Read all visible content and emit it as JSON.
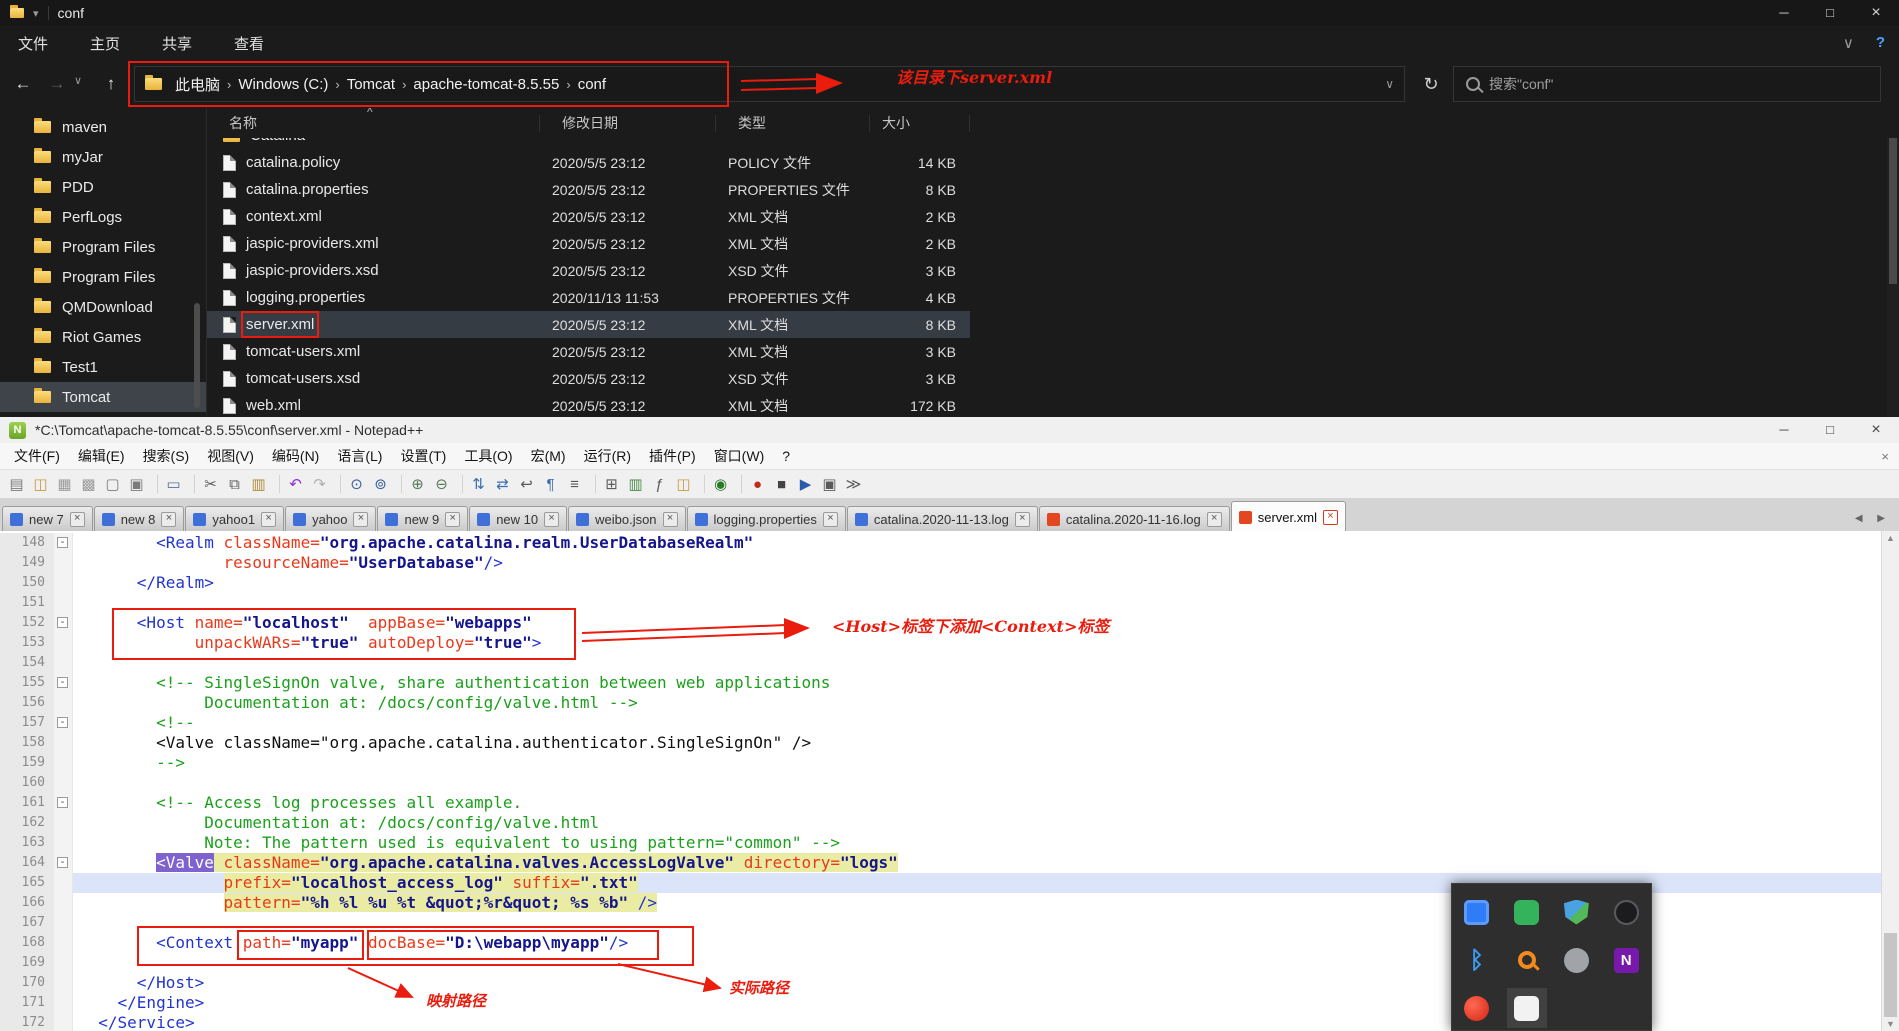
{
  "explorer": {
    "title": "conf",
    "window_controls": {
      "minimize": "─",
      "maximize": "□",
      "close": "×"
    },
    "menu_tabs": [
      "文件",
      "主页",
      "共享",
      "查看"
    ],
    "ribbon": {
      "collapse_caret": "∨",
      "help": "?"
    },
    "nav": {
      "back": "←",
      "forward": "→",
      "caret": "∨",
      "up": "↑",
      "refresh": "↻",
      "addr_caret": "∨"
    },
    "breadcrumb": [
      "此电脑",
      "Windows (C:)",
      "Tomcat",
      "apache-tomcat-8.5.55",
      "conf"
    ],
    "search_placeholder": "搜索\"conf\"",
    "columns": [
      "名称",
      "修改日期",
      "类型",
      "大小"
    ],
    "sort_caret": "^",
    "sidebar": [
      {
        "label": "maven"
      },
      {
        "label": "myJar"
      },
      {
        "label": "PDD"
      },
      {
        "label": "PerfLogs"
      },
      {
        "label": "Program Files"
      },
      {
        "label": "Program Files"
      },
      {
        "label": "QMDownload"
      },
      {
        "label": "Riot Games"
      },
      {
        "label": "Test1"
      },
      {
        "label": "Tomcat",
        "selected": true
      }
    ],
    "files": [
      {
        "name": "Catalina",
        "date": "",
        "type": "",
        "size": "",
        "folder": true,
        "clip_top": true
      },
      {
        "name": "catalina.policy",
        "date": "2020/5/5 23:12",
        "type": "POLICY 文件",
        "size": "14 KB"
      },
      {
        "name": "catalina.properties",
        "date": "2020/5/5 23:12",
        "type": "PROPERTIES 文件",
        "size": "8 KB"
      },
      {
        "name": "context.xml",
        "date": "2020/5/5 23:12",
        "type": "XML 文档",
        "size": "2 KB"
      },
      {
        "name": "jaspic-providers.xml",
        "date": "2020/5/5 23:12",
        "type": "XML 文档",
        "size": "2 KB"
      },
      {
        "name": "jaspic-providers.xsd",
        "date": "2020/5/5 23:12",
        "type": "XSD 文件",
        "size": "3 KB"
      },
      {
        "name": "logging.properties",
        "date": "2020/11/13 11:53",
        "type": "PROPERTIES 文件",
        "size": "4 KB"
      },
      {
        "name": "server.xml",
        "date": "2020/5/5 23:12",
        "type": "XML 文档",
        "size": "8 KB",
        "selected": true,
        "redbox": true
      },
      {
        "name": "tomcat-users.xml",
        "date": "2020/5/5 23:12",
        "type": "XML 文档",
        "size": "3 KB"
      },
      {
        "name": "tomcat-users.xsd",
        "date": "2020/5/5 23:12",
        "type": "XSD 文件",
        "size": "3 KB"
      },
      {
        "name": "web.xml",
        "date": "2020/5/5 23:12",
        "type": "XML 文档",
        "size": "172 KB"
      }
    ]
  },
  "notepad": {
    "title": "*C:\\Tomcat\\apache-tomcat-8.5.55\\conf\\server.xml - Notepad++",
    "icon_letter": "N",
    "window_controls": {
      "minimize": "─",
      "maximize": "□",
      "close": "×"
    },
    "menu_close": "×",
    "tab_scroll": "◀ ▶",
    "menus": [
      "文件(F)",
      "编辑(E)",
      "搜索(S)",
      "视图(V)",
      "编码(N)",
      "语言(L)",
      "设置(T)",
      "工具(O)",
      "宏(M)",
      "运行(R)",
      "插件(P)",
      "窗口(W)",
      "?"
    ],
    "toolbar": [
      {
        "name": "new-file-icon",
        "glyph": "▤",
        "color": "#7a7a7a"
      },
      {
        "name": "open-file-icon",
        "glyph": "◫",
        "color": "#c89a3f"
      },
      {
        "name": "save-icon",
        "glyph": "▦",
        "color": "#9a9a9a"
      },
      {
        "name": "save-all-icon",
        "glyph": "▩",
        "color": "#9a9a9a"
      },
      {
        "name": "close-doc-icon",
        "glyph": "▢",
        "color": "#7a7a7a"
      },
      {
        "name": "close-all-icon",
        "glyph": "▣",
        "color": "#7a7a7a"
      },
      {
        "sep": true
      },
      {
        "name": "print-icon",
        "glyph": "▭",
        "color": "#5a6f8a"
      },
      {
        "sep": true
      },
      {
        "name": "cut-icon",
        "glyph": "✂",
        "color": "#5a5a5a"
      },
      {
        "name": "copy-icon",
        "glyph": "⧉",
        "color": "#5a5a5a"
      },
      {
        "name": "paste-icon",
        "glyph": "▥",
        "color": "#b08a3a"
      },
      {
        "sep": true
      },
      {
        "name": "undo-icon",
        "glyph": "↶",
        "color": "#8a2be2"
      },
      {
        "name": "redo-icon",
        "glyph": "↷",
        "color": "#b0b0b0"
      },
      {
        "sep": true
      },
      {
        "name": "find-icon",
        "glyph": "⊙",
        "color": "#3a5f9a"
      },
      {
        "name": "replace-icon",
        "glyph": "⊚",
        "color": "#3a5f9a"
      },
      {
        "sep": true
      },
      {
        "name": "zoom-in-icon",
        "glyph": "⊕",
        "color": "#5a7a5a"
      },
      {
        "name": "zoom-out-icon",
        "glyph": "⊖",
        "color": "#5a7a5a"
      },
      {
        "sep": true
      },
      {
        "name": "sync-vertical-icon",
        "glyph": "⇅",
        "color": "#3a6fb0"
      },
      {
        "name": "sync-horizontal-icon",
        "glyph": "⇄",
        "color": "#3a6fb0"
      },
      {
        "name": "word-wrap-icon",
        "glyph": "↩",
        "color": "#5a5a5a"
      },
      {
        "name": "show-all-chars-icon",
        "glyph": "¶",
        "color": "#3a6fb0"
      },
      {
        "name": "indent-guide-icon",
        "glyph": "≡",
        "color": "#5a5a5a"
      },
      {
        "sep": true
      },
      {
        "name": "user-define-dialog-icon",
        "glyph": "⊞",
        "color": "#5a5a5a"
      },
      {
        "name": "doc-map-icon",
        "glyph": "▥",
        "color": "#4a8a4a"
      },
      {
        "name": "function-list-icon",
        "glyph": "ƒ",
        "color": "#5a5a5a"
      },
      {
        "name": "folder-workspace-icon",
        "glyph": "◫",
        "color": "#c89a3f"
      },
      {
        "sep": true
      },
      {
        "name": "monitoring-icon",
        "glyph": "◉",
        "color": "#2a7a2a"
      },
      {
        "sep": true
      },
      {
        "name": "record-macro-icon",
        "glyph": "●",
        "color": "#c22a1a"
      },
      {
        "name": "stop-macro-icon",
        "glyph": "■",
        "color": "#444444"
      },
      {
        "name": "play-macro-icon",
        "glyph": "▶",
        "color": "#2a5aaa"
      },
      {
        "name": "save-macro-icon",
        "glyph": "▣",
        "color": "#5a5a5a"
      },
      {
        "name": "run-multiple-icon",
        "glyph": "≫",
        "color": "#5a5a5a"
      }
    ],
    "tabs": [
      {
        "label": "new 7"
      },
      {
        "label": "new 8"
      },
      {
        "label": "yahoo1"
      },
      {
        "label": "yahoo"
      },
      {
        "label": "new 9"
      },
      {
        "label": "new 10"
      },
      {
        "label": "weibo.json"
      },
      {
        "label": "logging.properties"
      },
      {
        "label": "catalina.2020-11-13.log"
      },
      {
        "label": "catalina.2020-11-16.log",
        "modified": true
      },
      {
        "label": "server.xml",
        "modified": true,
        "active": true
      }
    ],
    "editor": {
      "lines": [
        {
          "n": 148,
          "indent": 8,
          "fold": true,
          "tok": [
            [
              "tag",
              "<Realm"
            ],
            [
              "plain",
              " "
            ],
            [
              "attr",
              "className="
            ],
            [
              "val",
              "\"org.apache.catalina.realm.UserDatabaseRealm\""
            ]
          ]
        },
        {
          "n": 149,
          "indent": 15,
          "tok": [
            [
              "attr",
              "resourceName="
            ],
            [
              "val",
              "\"UserDatabase\""
            ],
            [
              "tag",
              "/>"
            ]
          ]
        },
        {
          "n": 150,
          "indent": 6,
          "tok": [
            [
              "tag",
              "</Realm>"
            ]
          ]
        },
        {
          "n": 151,
          "indent": 0,
          "tok": []
        },
        {
          "n": 152,
          "indent": 6,
          "fold": true,
          "tok": [
            [
              "tag",
              "<Host"
            ],
            [
              "plain",
              " "
            ],
            [
              "attr",
              "name="
            ],
            [
              "val",
              "\"localhost\""
            ],
            [
              "plain",
              "  "
            ],
            [
              "attr",
              "appBase="
            ],
            [
              "val",
              "\"webapps\""
            ]
          ]
        },
        {
          "n": 153,
          "indent": 12,
          "tok": [
            [
              "attr",
              "unpackWARs="
            ],
            [
              "val",
              "\"true\""
            ],
            [
              "plain",
              " "
            ],
            [
              "attr",
              "autoDeploy="
            ],
            [
              "val",
              "\"true\""
            ],
            [
              "tag",
              ">"
            ]
          ]
        },
        {
          "n": 154,
          "indent": 0,
          "tok": []
        },
        {
          "n": 155,
          "indent": 8,
          "fold": true,
          "tok": [
            [
              "com",
              "<!-- SingleSignOn valve, share authentication between web applications"
            ]
          ]
        },
        {
          "n": 156,
          "indent": 13,
          "tok": [
            [
              "com",
              "Documentation at: /docs/config/valve.html -->"
            ]
          ]
        },
        {
          "n": 157,
          "indent": 8,
          "fold": true,
          "tok": [
            [
              "com",
              "<!--"
            ]
          ]
        },
        {
          "n": 158,
          "indent": 8,
          "tok": [
            [
              "plain",
              "<Valve className=\"org.apache.catalina.authenticator.SingleSignOn\" />"
            ]
          ]
        },
        {
          "n": 159,
          "indent": 8,
          "tok": [
            [
              "com",
              "-->"
            ]
          ]
        },
        {
          "n": 160,
          "indent": 0,
          "tok": []
        },
        {
          "n": 161,
          "indent": 8,
          "fold": true,
          "tok": [
            [
              "com",
              "<!-- Access log processes all example."
            ]
          ]
        },
        {
          "n": 162,
          "indent": 13,
          "tok": [
            [
              "com",
              "Documentation at: /docs/config/valve.html"
            ]
          ]
        },
        {
          "n": 163,
          "indent": 13,
          "tok": [
            [
              "com",
              "Note: The pattern used is equivalent to using pattern=\"common\" -->"
            ]
          ]
        },
        {
          "n": 164,
          "indent": 8,
          "fold": true,
          "tok": [
            [
              "tagsel",
              "<Valve"
            ],
            [
              "plain-hl",
              " "
            ],
            [
              "attr-hl",
              "className="
            ],
            [
              "val-hl",
              "\"org.apache.catalina.valves.AccessLogValve\""
            ],
            [
              "plain-hl",
              " "
            ],
            [
              "attr-hl",
              "directory="
            ],
            [
              "val-hl",
              "\"logs\""
            ]
          ]
        },
        {
          "n": 165,
          "indent": 15,
          "cur": true,
          "tok": [
            [
              "attr-hl",
              "prefix="
            ],
            [
              "val-hl",
              "\"localhost_access_log\""
            ],
            [
              "plain-hl",
              " "
            ],
            [
              "attr-hl",
              "suffix="
            ],
            [
              "val-hl",
              "\".txt\""
            ]
          ]
        },
        {
          "n": 166,
          "indent": 15,
          "tok": [
            [
              "attr-hl",
              "pattern="
            ],
            [
              "val-hl",
              "\"%h %l %u %t &quot;%r&quot; %s %b\""
            ],
            [
              "plain-hl",
              " "
            ],
            [
              "tag-hl",
              "/>"
            ]
          ]
        },
        {
          "n": 167,
          "indent": 0,
          "tok": []
        },
        {
          "n": 168,
          "indent": 8,
          "tok": [
            [
              "tag",
              "<Context"
            ],
            [
              "plain",
              " "
            ],
            [
              "attr",
              "path="
            ],
            [
              "val",
              "\"myapp\""
            ],
            [
              "plain",
              " "
            ],
            [
              "attr",
              "docBase="
            ],
            [
              "val",
              "\"D:\\webapp\\myapp\""
            ],
            [
              "tag",
              "/>"
            ]
          ]
        },
        {
          "n": 169,
          "indent": 0,
          "tok": []
        },
        {
          "n": 170,
          "indent": 6,
          "tok": [
            [
              "tag",
              "</Host>"
            ]
          ]
        },
        {
          "n": 171,
          "indent": 4,
          "tok": [
            [
              "tag",
              "</Engine>"
            ]
          ]
        },
        {
          "n": 172,
          "indent": 2,
          "tok": [
            [
              "tag",
              "</Service>"
            ]
          ]
        }
      ]
    }
  },
  "annotations": {
    "path_note": "该目录下server.xml",
    "host_note": "<Host>标签下添加<Context>标签",
    "mapping_note": "映射路径",
    "actual_note": "实际路径"
  },
  "tray": {
    "icons": [
      {
        "name": "tray-blue-app-icon",
        "cls": "ti-bluewin"
      },
      {
        "name": "tray-green-app-icon",
        "cls": "ti-green"
      },
      {
        "name": "defender-shield-icon",
        "cls": "ti-shield"
      },
      {
        "name": "tray-dark-app-icon",
        "cls": "ti-dark"
      },
      {
        "name": "bluetooth-icon",
        "cls": "ti-bt",
        "glyph": "ᛒ"
      },
      {
        "name": "search-magnifier-orange-icon",
        "cls": "ti-orange"
      },
      {
        "name": "tray-gray-circle-icon",
        "cls": "ti-gray"
      },
      {
        "name": "onenote-icon",
        "cls": "ti-purple",
        "glyph": "N"
      },
      {
        "name": "tray-red-app-icon",
        "cls": "ti-red"
      },
      {
        "name": "tray-white-app-icon",
        "cls": "ti-white",
        "hover": true
      }
    ]
  }
}
